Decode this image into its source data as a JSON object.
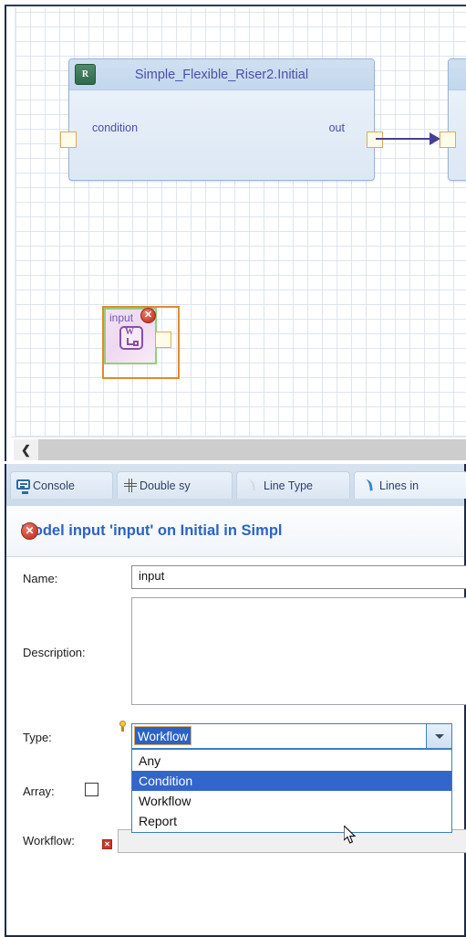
{
  "canvas": {
    "nodes": [
      {
        "icon": "R",
        "title": "Simple_Flexible_Riser2.Initial",
        "input_port_label": "condition",
        "output_port_label": "out"
      }
    ],
    "selected_node": {
      "label": "input",
      "icon_letter": "W",
      "error_mark": "✕"
    },
    "scrollbar": {
      "left_arrow": "❮"
    }
  },
  "tabs": [
    {
      "label": "Console",
      "icon": "monitor-icon",
      "active": false
    },
    {
      "label": "Double sy",
      "icon": "crosshair-icon",
      "active": false
    },
    {
      "label": "Line Type",
      "icon": "curve-gray-icon",
      "active": false
    },
    {
      "label": "Lines in",
      "icon": "curve-blue-icon",
      "active": true
    }
  ],
  "form": {
    "error_glyph": "✕",
    "title": "Model input 'input' on Initial in Simpl",
    "fields": {
      "name_label": "Name:",
      "name_value": "input",
      "description_label": "Description:",
      "description_value": "",
      "type_label": "Type:",
      "type_value": "Workflow",
      "array_label": "Array:",
      "array_checked": false,
      "workflow_label": "Workflow:",
      "workflow_value": "",
      "workflow_error": "✕"
    },
    "type_dropdown": {
      "open": true,
      "options": [
        "Any",
        "Condition",
        "Workflow",
        "Report"
      ],
      "highlighted": "Condition"
    }
  },
  "colors": {
    "accent_blue": "#2b63c4",
    "selection_blue": "#3266ca",
    "error_red": "#c9392b",
    "node_title_purple": "#4a4fa8",
    "port_border_orange": "#e0a95c",
    "link_purple": "#463f94",
    "selected_node_orange": "#e08a2e",
    "selected_node_green": "#93cf7e",
    "workflow_icon_purple": "#8a4fa8"
  }
}
